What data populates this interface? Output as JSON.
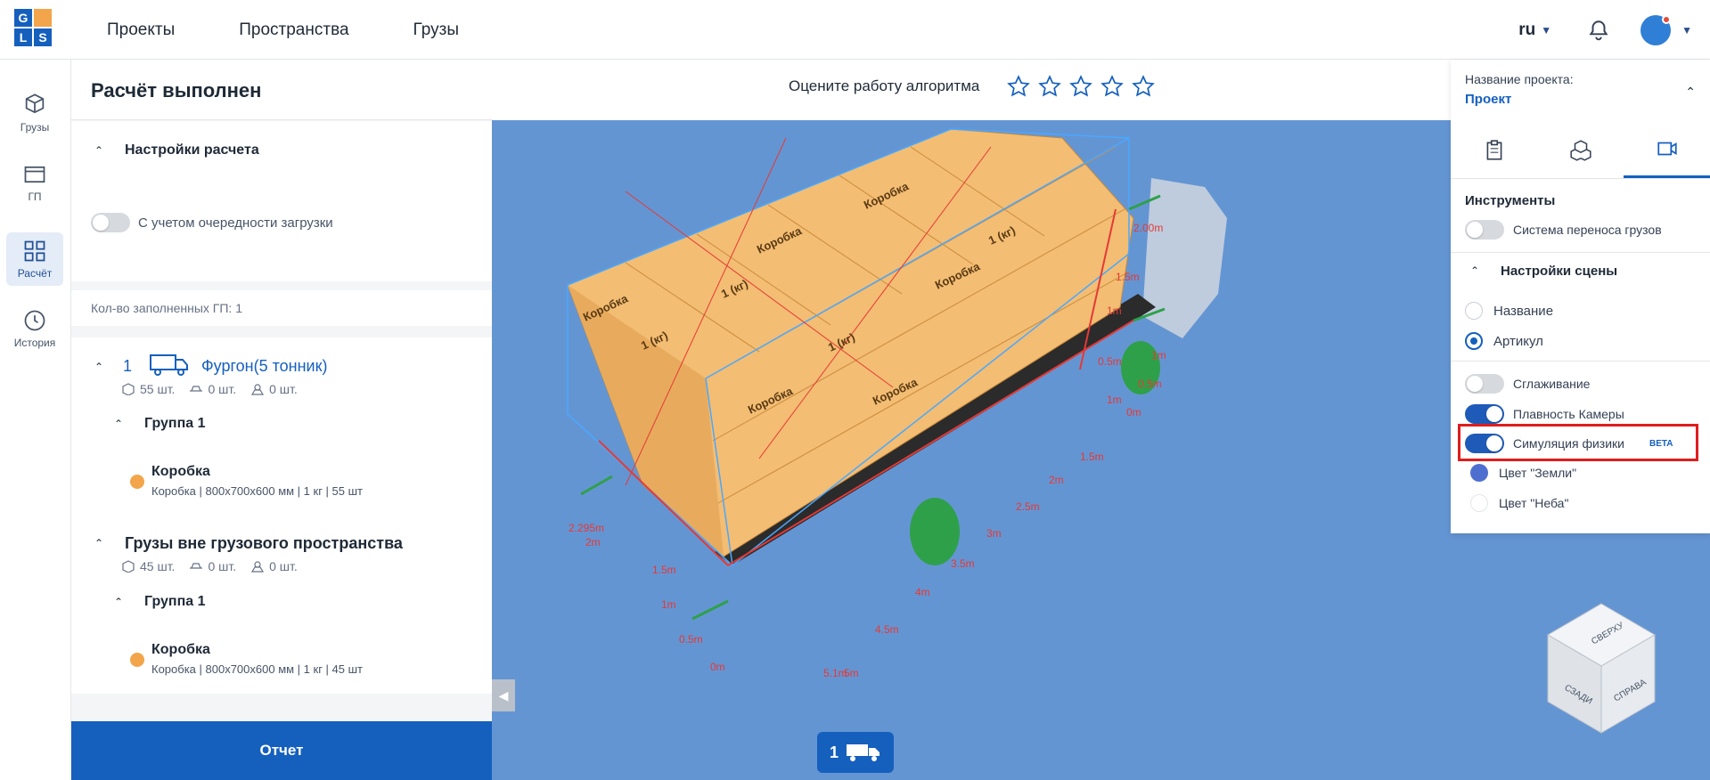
{
  "nav": {
    "logo_letters": [
      "G",
      "L",
      "S"
    ],
    "items": [
      "Проекты",
      "Пространства",
      "Грузы"
    ]
  },
  "topright": {
    "language": "ru"
  },
  "leftnav": [
    {
      "label": "Грузы",
      "icon": "cargo-box-icon",
      "active": false
    },
    {
      "label": "ГП",
      "icon": "cargo-space-icon",
      "active": false
    },
    {
      "label": "Расчёт",
      "icon": "calculation-grid-icon",
      "active": true
    },
    {
      "label": "История",
      "icon": "history-clock-icon",
      "active": false
    }
  ],
  "leftpanel": {
    "title": "Расчёт выполнен",
    "settings_title": "Настройки расчета",
    "queue_toggle_label": "С учетом очередности загрузки",
    "filled_count": "Кол-во заполненных ГП: 1",
    "vehicle": {
      "index": "1",
      "name": "Фургон(5 тонник)",
      "counts": [
        "55 шт.",
        "0 шт.",
        "0 шт."
      ],
      "group_title": "Группа 1",
      "item_name": "Коробка",
      "item_desc": "Коробка | 800x700x600 мм | 1 кг | 55 шт"
    },
    "outside": {
      "title": "Грузы вне грузового пространства",
      "counts": [
        "45 шт.",
        "0 шт.",
        "0 шт."
      ],
      "group_title": "Группа 1",
      "item_name": "Коробка",
      "item_desc": "Коробка | 800x700x600 мм | 1 кг | 45 шт"
    },
    "report_button": "Отчет"
  },
  "scene": {
    "rate_text": "Оцените работу алгоритма",
    "stars_filled": 0,
    "stars_total": 5,
    "box_label": "Коробка",
    "box_weight": "1 (кг)",
    "ruler_front": [
      "0m",
      "0.5m",
      "1m",
      "1.5m",
      "2m",
      "2.295m"
    ],
    "ruler_side": [
      "1m",
      "1.5m",
      "2m",
      "2.5m",
      "3m",
      "3.5m",
      "4m",
      "4.5m",
      "5m",
      "5.1m"
    ],
    "ruler_right": [
      "0.5m",
      "1m",
      "1.5m",
      "2.00m"
    ],
    "ruler_rear": [
      "0m",
      "0.5m",
      "1m"
    ],
    "truck_tab_number": "1",
    "cube_faces": [
      "СВЕРХУ",
      "СЗАДИ",
      "СПРАВА"
    ]
  },
  "rightpanel": {
    "project_label": "Название проекта:",
    "project_name": "Проект",
    "tools_title": "Инструменты",
    "transfer_toggle": "Система переноса грузов",
    "scene_settings_title": "Настройки сцены",
    "radio_name": "Название",
    "radio_article": "Артикул",
    "smoothing": "Сглаживание",
    "camera_smooth": "Плавность Камеры",
    "physics": "Симуляция физики",
    "beta": "BETA",
    "ground_color": "Цвет \"Земли\"",
    "sky_color": "Цвет \"Неба\""
  },
  "colors": {
    "accent": "#1560bd",
    "scene_bg": "#6495d3",
    "box": "#f3bd73",
    "ground_dot": "#4f6fd0",
    "highlight": "#e11d1d"
  }
}
